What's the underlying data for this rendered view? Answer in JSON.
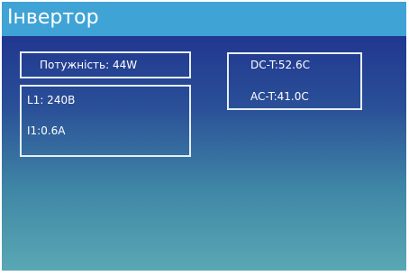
{
  "window": {
    "title": "Інвертор"
  },
  "power_panel": {
    "power_label": "Потужність: 44W"
  },
  "line_panel": {
    "voltage_label": "L1: 240В",
    "current_label": "I1:0.6A"
  },
  "temperature_panel": {
    "dc_temp_label": "DC-T:52.6C",
    "ac_temp_label": "AC-T:41.0C"
  },
  "colors": {
    "title_bar": "#3fa3d6",
    "background_top": "#213790",
    "background_bottom": "#5aa8b4",
    "border": "#e6eef6",
    "text": "#ffffff"
  }
}
